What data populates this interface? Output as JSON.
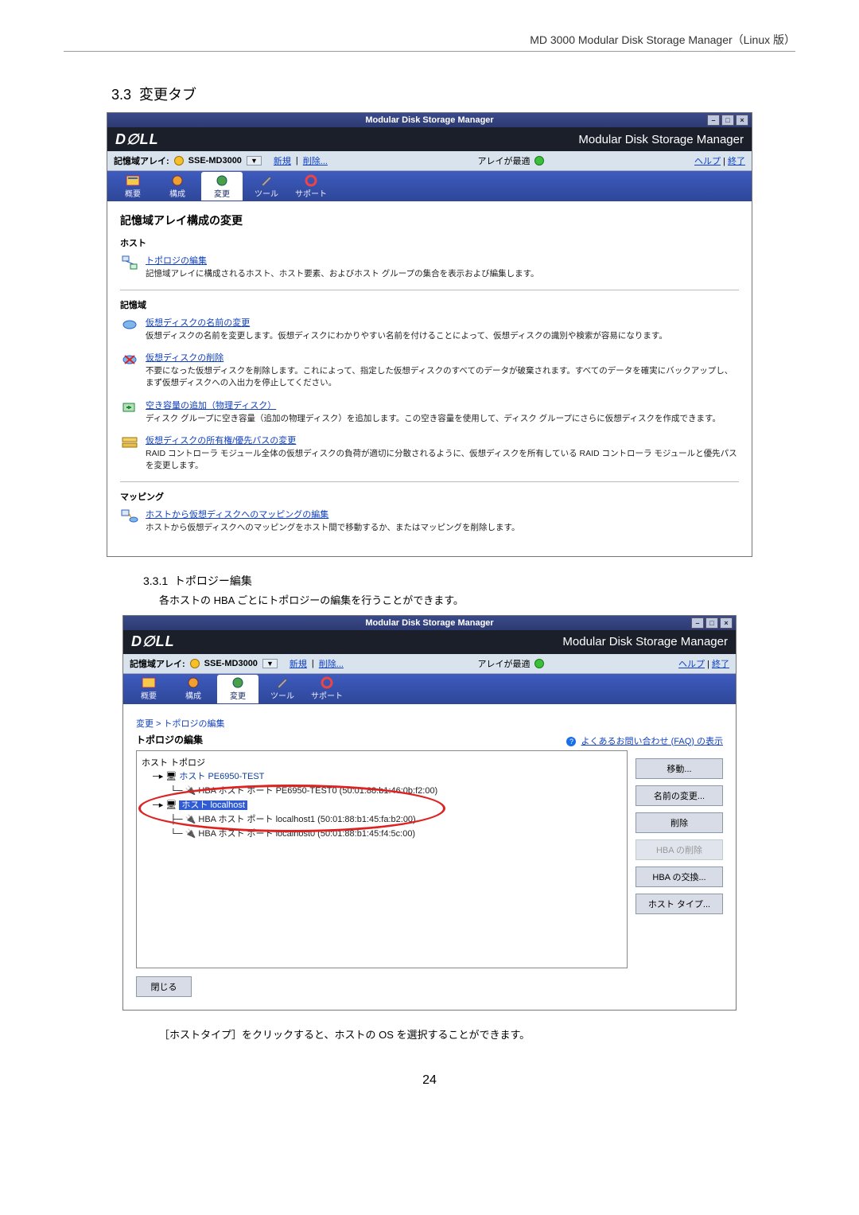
{
  "doc": {
    "header": "MD 3000 Modular Disk Storage Manager（Linux 版）",
    "section_no": "3.3",
    "section_title": "変更タブ",
    "subsection_no": "3.3.1",
    "subsection_title": "トポロジー編集",
    "subsection_text": "各ホストの HBA ごとにトポロジーの編集を行うことができます。",
    "bottom_text": "［ホストタイプ］をクリックすると、ホストの OS を選択することができます。",
    "page_num": "24"
  },
  "screenshot1": {
    "window_title": "Modular Disk Storage Manager",
    "brand_right": "Modular Disk Storage Manager",
    "toolbar": {
      "label": "記憶域アレイ:",
      "array_name": "SSE-MD3000",
      "new_link": "新規",
      "remove_link": "削除...",
      "status_label": "アレイが最適",
      "help_link": "ヘルプ",
      "exit_link": "終了"
    },
    "tabs": [
      "概要",
      "構成",
      "変更",
      "ツール",
      "サポート"
    ],
    "pane_title": "記憶域アレイ構成の変更",
    "groups": {
      "host": {
        "label": "ホスト",
        "entries": [
          {
            "title": "トポロジの編集",
            "desc": "記憶域アレイに構成されるホスト、ホスト要素、およびホスト グループの集合を表示および編集します。"
          }
        ]
      },
      "store": {
        "label": "記憶域",
        "entries": [
          {
            "title": "仮想ディスクの名前の変更",
            "desc": "仮想ディスクの名前を変更します。仮想ディスクにわかりやすい名前を付けることによって、仮想ディスクの識別や検索が容易になります。"
          },
          {
            "title": "仮想ディスクの削除",
            "desc": "不要になった仮想ディスクを削除します。これによって、指定した仮想ディスクのすべてのデータが破棄されます。すべてのデータを確実にバックアップし、まず仮想ディスクへの入出力を停止してください。"
          },
          {
            "title": "空き容量の追加（物理ディスク）",
            "desc": "ディスク グループに空き容量（追加の物理ディスク）を追加します。この空き容量を使用して、ディスク グループにさらに仮想ディスクを作成できます。"
          },
          {
            "title": "仮想ディスクの所有権/優先パスの変更",
            "desc": "RAID コントローラ モジュール全体の仮想ディスクの負荷が適切に分散されるように、仮想ディスクを所有している RAID コントローラ モジュールと優先パスを変更します。"
          }
        ]
      },
      "mapping": {
        "label": "マッピング",
        "entries": [
          {
            "title": "ホストから仮想ディスクへのマッピングの編集",
            "desc": "ホストから仮想ディスクへのマッピングをホスト間で移動するか、またはマッピングを削除します。"
          }
        ]
      }
    }
  },
  "screenshot2": {
    "window_title": "Modular Disk Storage Manager",
    "brand_right": "Modular Disk Storage Manager",
    "toolbar": {
      "label": "記憶域アレイ:",
      "array_name": "SSE-MD3000",
      "new_link": "新規",
      "remove_link": "削除...",
      "status_label": "アレイが最適",
      "help_link": "ヘルプ",
      "exit_link": "終了"
    },
    "tabs": [
      "概要",
      "構成",
      "変更",
      "ツール",
      "サポート"
    ],
    "breadcrumb": "変更 > トポロジの編集",
    "topo_title": "トポロジの編集",
    "faq_link": "よくあるお問い合わせ (FAQ) の表示",
    "tree_root": "ホスト トポロジ",
    "tree": {
      "host1": "ホスト PE6950-TEST",
      "host1_hba": "HBA ホスト ポート PE6950-TEST0 (50:01:88:b1:46:0b:f2:00)",
      "host2": "ホスト localhost",
      "host2_hba1": "HBA ホスト ポート localhost1 (50:01:88:b1:45:fa:b2:00)",
      "host2_hba2": "HBA ホスト ポート localhost0 (50:01:88:b1:45:f4:5c:00)"
    },
    "buttons": {
      "move": "移動...",
      "rename": "名前の変更...",
      "remove": "削除",
      "hba_remove": "HBA の削除",
      "hba_swap": "HBA の交換...",
      "host_type": "ホスト タイプ..."
    },
    "close_btn": "閉じる"
  }
}
